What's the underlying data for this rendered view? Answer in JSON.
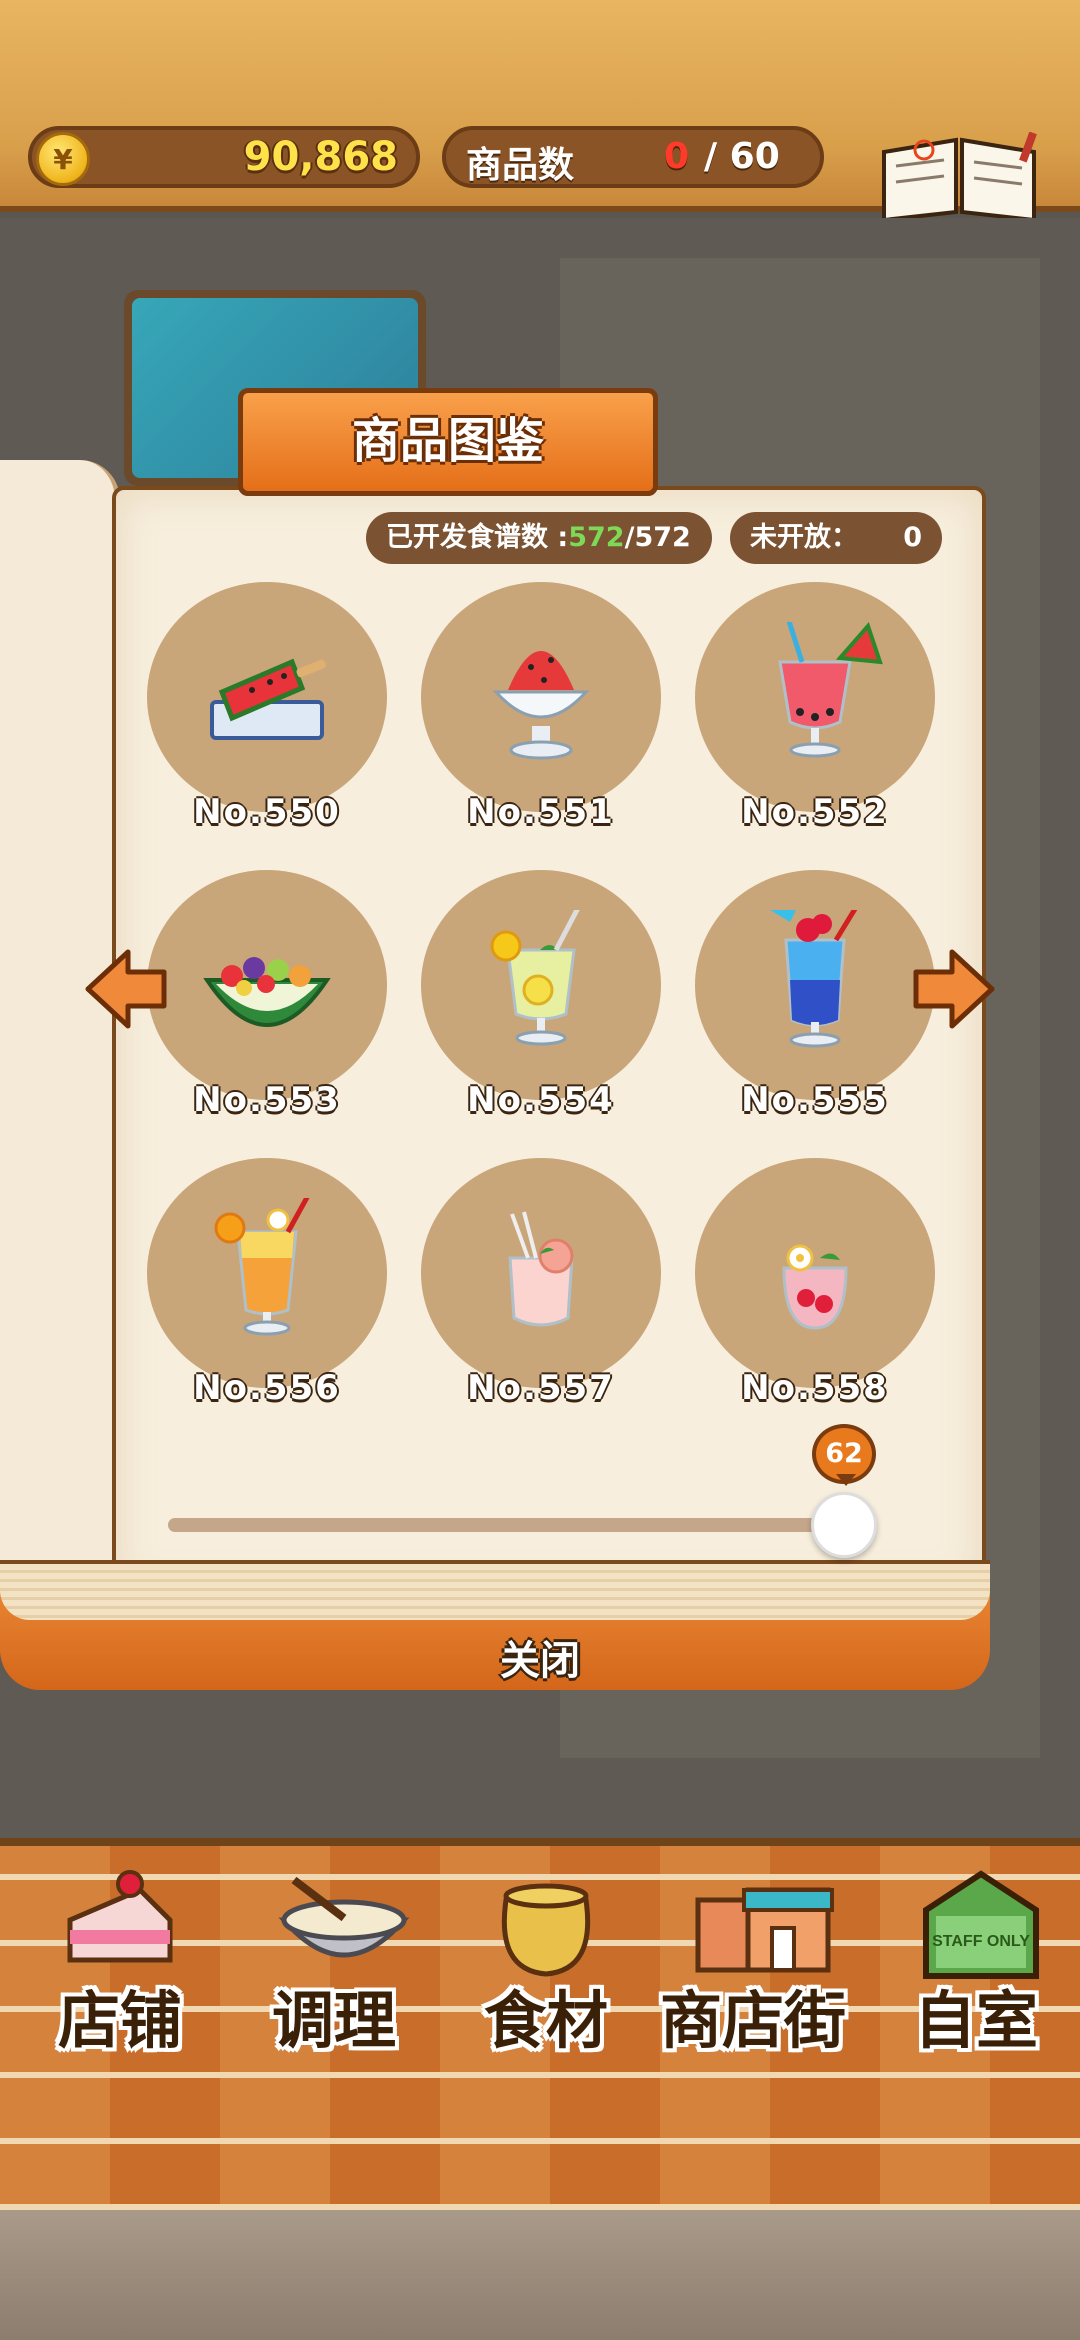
{
  "header": {
    "money_symbol": "¥",
    "money": "90,868",
    "goods_label": "商品数",
    "goods_count": "0",
    "goods_total": "/ 60",
    "recipe_label": "食谱"
  },
  "book": {
    "title": "商品图鉴",
    "developed_label": "已开发食谱数 :",
    "developed_count": "572",
    "developed_total": "/572",
    "unopened_label": "未开放：",
    "unopened_value": "0",
    "items": [
      {
        "no": "No.550",
        "icon": "watermelon-popsicle-icon"
      },
      {
        "no": "No.551",
        "icon": "watermelon-shaved-ice-icon"
      },
      {
        "no": "No.552",
        "icon": "watermelon-juice-icon"
      },
      {
        "no": "No.553",
        "icon": "watermelon-fruit-bowl-icon"
      },
      {
        "no": "No.554",
        "icon": "lemon-soda-icon"
      },
      {
        "no": "No.555",
        "icon": "blue-tropical-drink-icon"
      },
      {
        "no": "No.556",
        "icon": "orange-cocktail-icon"
      },
      {
        "no": "No.557",
        "icon": "peach-drink-icon"
      },
      {
        "no": "No.558",
        "icon": "strawberry-drink-icon"
      }
    ],
    "page_value": "62",
    "page_progress": 1.0,
    "close_label": "关闭"
  },
  "nav": [
    {
      "label": "店铺",
      "icon": "cake-icon"
    },
    {
      "label": "调理",
      "icon": "mixing-bowl-icon"
    },
    {
      "label": "食材",
      "icon": "ingredient-sack-icon"
    },
    {
      "label": "商店街",
      "icon": "shop-street-icon"
    },
    {
      "label": "自室",
      "icon": "staff-only-sign-icon"
    }
  ],
  "staff_sign": "STAFF ONLY"
}
